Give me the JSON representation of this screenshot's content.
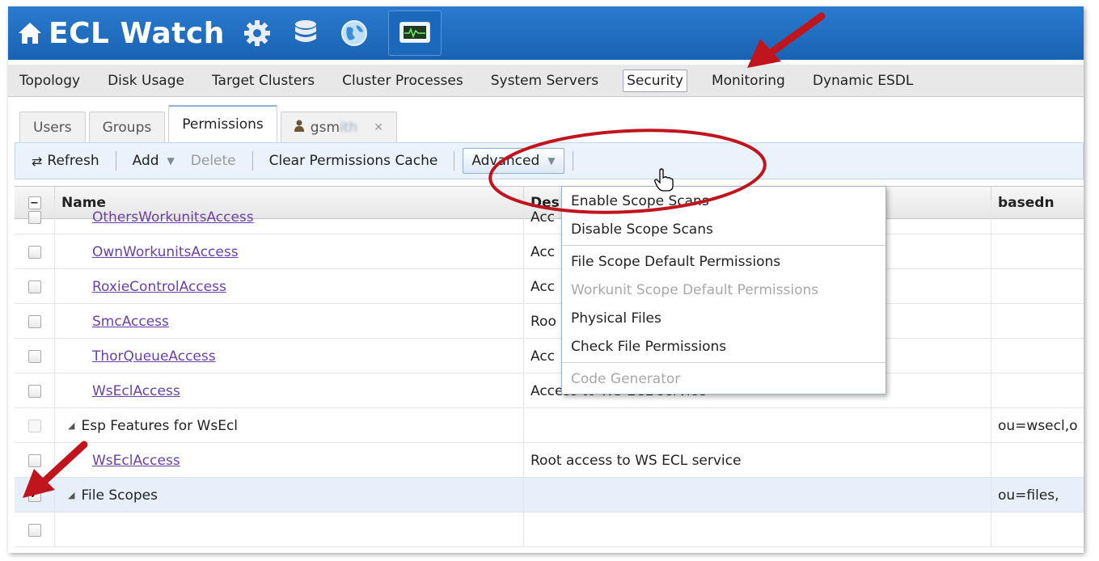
{
  "app": {
    "title": "ECL Watch",
    "brand_color": "#1f6fc2",
    "header_icons": [
      "home-icon",
      "gear-icon",
      "database-icon",
      "globe-icon",
      "monitor-icon"
    ]
  },
  "nav": {
    "items": [
      "Topology",
      "Disk Usage",
      "Target Clusters",
      "Cluster Processes",
      "System Servers",
      "Security",
      "Monitoring",
      "Dynamic ESDL"
    ],
    "active": "Security"
  },
  "tabs": [
    {
      "label": "Users"
    },
    {
      "label": "Groups"
    },
    {
      "label": "Permissions",
      "active": true
    },
    {
      "label": "gsm",
      "label_obscured": "ith",
      "icon": "user-icon",
      "closable": true
    }
  ],
  "toolbar": {
    "refresh": "Refresh",
    "add": "Add",
    "delete": "Delete",
    "clear_cache": "Clear Permissions Cache",
    "advanced": "Advanced"
  },
  "grid": {
    "columns": {
      "name": "Name",
      "description": "Des",
      "basedn": "basedn"
    },
    "rows": [
      {
        "name": "OthersWorkunitsAccess",
        "description": "Acc",
        "basedn": "",
        "type": "link"
      },
      {
        "name": "OwnWorkunitsAccess",
        "description": "Acc",
        "basedn": "",
        "type": "link"
      },
      {
        "name": "RoxieControlAccess",
        "description": "Acc",
        "basedn": "",
        "type": "link"
      },
      {
        "name": "SmcAccess",
        "description": "Roo",
        "basedn": "",
        "type": "link"
      },
      {
        "name": "ThorQueueAccess",
        "description": "Acc",
        "basedn": "",
        "type": "link"
      },
      {
        "name": "WsEclAccess",
        "description": "Access to WS ECL service",
        "basedn": "",
        "type": "link"
      },
      {
        "name": "Esp Features for WsEcl",
        "description": "",
        "basedn": "ou=wsecl,o",
        "type": "group"
      },
      {
        "name": "WsEclAccess",
        "description": "Root access to WS ECL service",
        "basedn": "",
        "type": "link"
      },
      {
        "name": "File Scopes",
        "description": "",
        "basedn": "ou=files,",
        "type": "group",
        "checked": true
      }
    ]
  },
  "advanced_menu": {
    "items": [
      {
        "label": "Enable Scope Scans",
        "enabled": true
      },
      {
        "label": "Disable Scope Scans",
        "enabled": true
      },
      {
        "separator": true
      },
      {
        "label": "File Scope Default Permissions",
        "enabled": true
      },
      {
        "label": "Workunit Scope Default Permissions",
        "enabled": false
      },
      {
        "label": "Physical Files",
        "enabled": true
      },
      {
        "label": "Check File Permissions",
        "enabled": true
      },
      {
        "separator": true
      },
      {
        "label": "Code Generator",
        "enabled": false
      }
    ]
  },
  "annotation_color": "#c0151c"
}
